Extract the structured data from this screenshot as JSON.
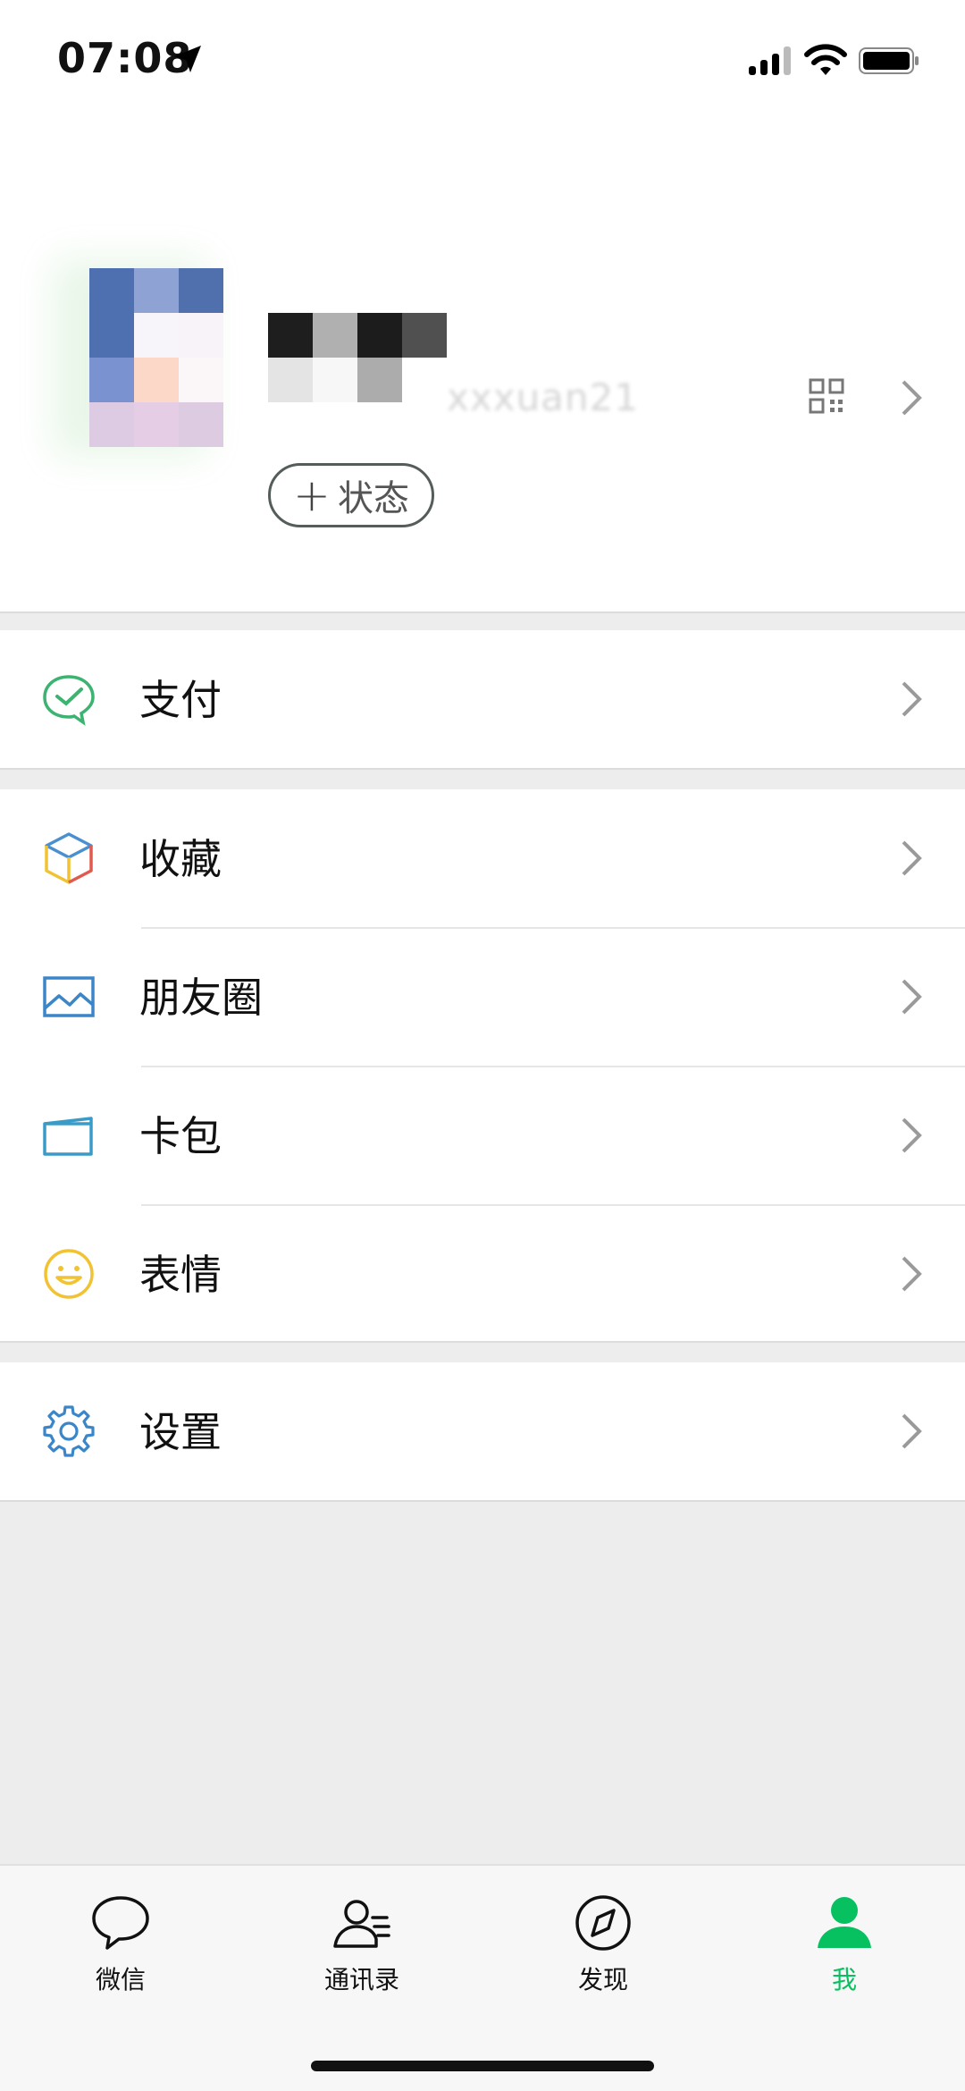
{
  "status_bar": {
    "time": "07:08"
  },
  "profile": {
    "wechat_id_blurred": "xxxuan21",
    "status_button": {
      "plus": "+",
      "label": "状态"
    }
  },
  "menu": {
    "pay": "支付",
    "favorites": "收藏",
    "moments": "朋友圈",
    "cards": "卡包",
    "stickers": "表情",
    "settings": "设置"
  },
  "tabs": [
    {
      "label": "微信",
      "icon": "chat-bubble-icon"
    },
    {
      "label": "通讯录",
      "icon": "contacts-icon"
    },
    {
      "label": "发现",
      "icon": "compass-icon"
    },
    {
      "label": "我",
      "icon": "person-icon",
      "active": true
    }
  ],
  "colors": {
    "accent": "#07c160",
    "background": "#ededed",
    "row_bg": "#ffffff"
  }
}
